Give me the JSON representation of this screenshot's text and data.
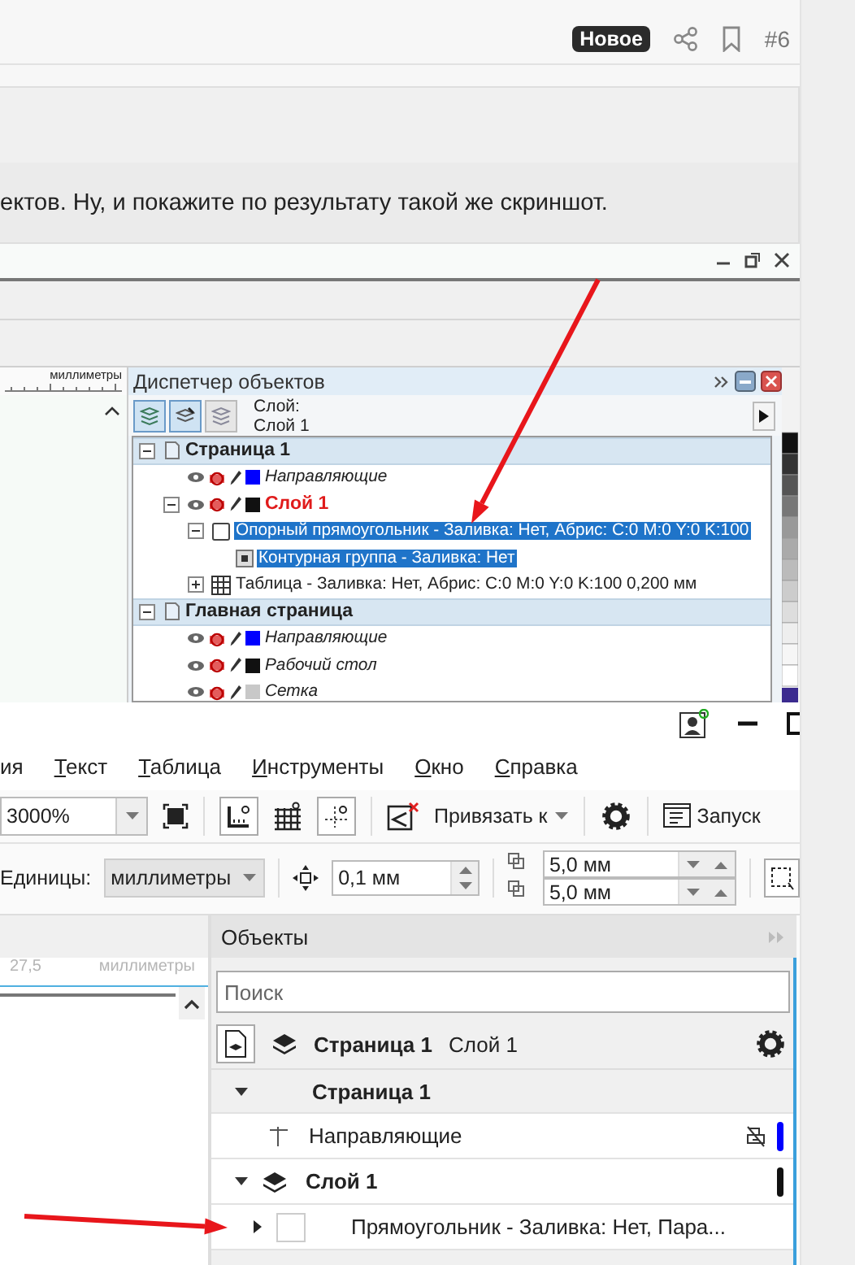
{
  "post": {
    "badge": "Новое",
    "number": "#6"
  },
  "quote": {
    "text": "ектов. Ну, и покажите по результату такой же скриншот."
  },
  "screenshot_1": {
    "ruler_unit": "миллиметры",
    "docker": {
      "title": "Диспетчер объектов",
      "layer_label": "Слой:",
      "layer_name": "Слой 1",
      "tree": [
        {
          "label": "Страница 1",
          "kind": "page",
          "expanded": true,
          "selected": false,
          "children": [
            {
              "label": "Направляющие",
              "kind": "layer",
              "color": "#0000ff",
              "selected": false
            },
            {
              "label": "Слой 1",
              "kind": "active-layer",
              "color": "#111111",
              "expanded": true,
              "selected": false,
              "children": [
                {
                  "label": "Опорный прямоугольник - Заливка: Нет, Абрис: C:0 M:0 Y:0 K:100",
                  "kind": "object",
                  "expanded": true,
                  "selected": true,
                  "children": [
                    {
                      "label": "Контурная группа - Заливка: Нет",
                      "kind": "group",
                      "selected": true
                    }
                  ]
                },
                {
                  "label": "Таблица - Заливка: Нет, Абрис: C:0 M:0 Y:0 K:100  0,200 мм",
                  "kind": "table",
                  "expanded": false,
                  "selected": false
                }
              ]
            }
          ]
        },
        {
          "label": "Главная страница",
          "kind": "page",
          "expanded": true,
          "selected": false,
          "children": [
            {
              "label": "Направляющие",
              "kind": "layer",
              "color": "#0000ff",
              "selected": false
            },
            {
              "label": "Рабочий стол",
              "kind": "layer",
              "color": "#111111",
              "selected": false
            },
            {
              "label": "Сетка",
              "kind": "layer",
              "color": "#c8c8c8",
              "selected": false
            }
          ]
        }
      ]
    }
  },
  "screenshot_2": {
    "menu": [
      "ия",
      "Текст",
      "Таблица",
      "Инструменты",
      "Окно",
      "Справка"
    ],
    "toolbar": {
      "zoom": "3000%",
      "snap": "Привязать к",
      "launch": "Запуск"
    },
    "property_bar": {
      "units_label": "Единицы:",
      "units": "миллиметры",
      "nudge": "0,1 мм",
      "duplicate_x": "5,0 мм",
      "duplicate_y": "5,0 мм"
    },
    "ruler": {
      "value": "27,5",
      "unit": "миллиметры"
    },
    "docker": {
      "title": "Объекты",
      "search": {
        "placeholder": "Поиск"
      },
      "current_page": "Страница 1",
      "current_layer": "Слой 1",
      "tree": [
        {
          "label": "Страница 1",
          "kind": "page",
          "expanded": true,
          "children": [
            {
              "label": "Направляющие",
              "kind": "guides",
              "color": "#0000ff"
            },
            {
              "label": "Слой 1",
              "kind": "layer",
              "color": "#111111",
              "expanded": true,
              "children": [
                {
                  "label": "Прямоугольник - Заливка: Нет, Пара...",
                  "kind": "object",
                  "expanded": false
                }
              ]
            }
          ]
        }
      ]
    }
  }
}
